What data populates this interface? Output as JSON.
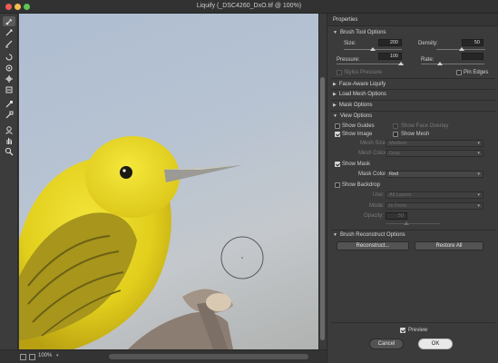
{
  "window": {
    "title": "Liquify (_DSC4260_DxO.tif @ 100%)"
  },
  "tools": [
    "forward-warp",
    "reconstruct",
    "smooth",
    "twirl-clockwise",
    "pucker",
    "bloat",
    "push-left",
    "freeze-mask",
    "thaw-mask",
    "face",
    "hand",
    "zoom"
  ],
  "status": {
    "zoom": "100%"
  },
  "panel": {
    "title": "Properties",
    "brush_tool_options": {
      "heading": "Brush Tool Options",
      "size_label": "Size:",
      "size_value": "200",
      "density_label": "Density:",
      "density_value": "50",
      "pressure_label": "Pressure:",
      "pressure_value": "100",
      "rate_label": "Rate:",
      "rate_value": "",
      "stylus_pressure": "Stylus Pressure",
      "pin_edges": "Pin Edges"
    },
    "collapsed_sections": [
      "Face-Aware Liquify",
      "Load Mesh Options",
      "Mask Options"
    ],
    "view_options": {
      "heading": "View Options",
      "show_guides": "Show Guides",
      "show_face_overlay": "Show Face Overlay",
      "show_image": "Show Image",
      "show_mesh": "Show Mesh",
      "mesh_size_label": "Mesh Size:",
      "mesh_size_value": "Medium",
      "mesh_color_label": "Mesh Color:",
      "mesh_color_value": "Gray",
      "show_mask": "Show Mask",
      "mask_color_label": "Mask Color:",
      "mask_color_value": "Red",
      "show_backdrop": "Show Backdrop",
      "use_label": "Use:",
      "use_value": "All Layers",
      "mode_label": "Mode:",
      "mode_value": "In Front",
      "opacity_label": "Opacity:",
      "opacity_value": "50"
    },
    "brush_reconstruct": {
      "heading": "Brush Reconstruct Options",
      "reconstruct_button": "Reconstruct...",
      "restore_all_button": "Restore All"
    },
    "preview_label": "Preview",
    "cancel_button": "Cancel",
    "ok_button": "OK"
  },
  "colors": {
    "panel_bg": "#3b3b3b",
    "canvas_sky": "#b7c3d2",
    "bird_yellow": "#e6d41e",
    "close": "#ee5c54",
    "minimize": "#f4bd50",
    "maximize": "#5fc454"
  }
}
